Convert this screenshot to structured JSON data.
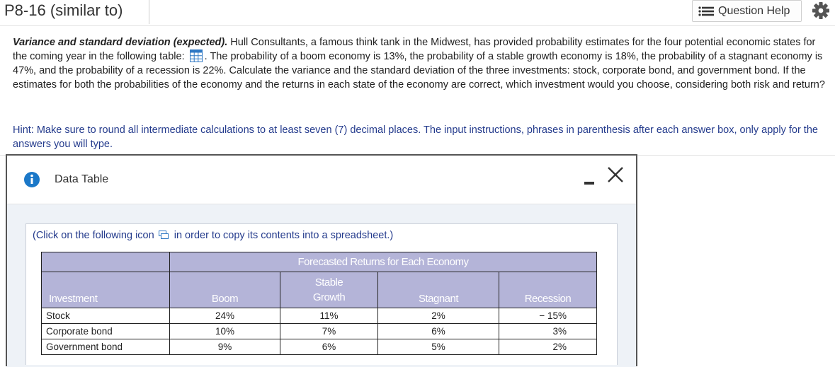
{
  "header": {
    "title": "P8-16 (similar to)",
    "question_help_label": "Question Help"
  },
  "question": {
    "lead": "Variance and standard deviation (expected).",
    "part1": " Hull Consultants, a famous think tank in the Midwest, has provided probability estimates for the four potential economic states for the coming year in the following table: ",
    "part2": ". The probability of a boom economy is 13%, the probability of a stable growth economy is 18%, the probability of a stagnant economy is 47%, and the probability of a recession is 22%. Calculate the variance and the standard deviation of the three investments: stock, corporate bond, and government bond. If the estimates for both the probabilities of the economy and the returns in each state of the economy are correct, which investment would you choose, considering both risk and return?"
  },
  "hint": "Hint: Make sure to round all intermediate calculations to at least seven (7) decimal places. The input instructions, phrases in parenthesis after each answer box, only apply for the answers you will type.",
  "dialog": {
    "title": "Data Table",
    "copy_note_before": "(Click on the following icon",
    "copy_note_after": "in order to copy its contents into a spreadsheet.)",
    "table": {
      "group_header": "Forecasted Returns for Each Economy",
      "columns": [
        "Investment",
        "Boom",
        "Stable Growth",
        "Stagnant",
        "Recession"
      ],
      "rows": [
        [
          "Stock",
          "24%",
          "11%",
          "2%",
          "− 15%"
        ],
        [
          "Corporate bond",
          "10%",
          "7%",
          "6%",
          "3%"
        ],
        [
          "Government bond",
          "9%",
          "6%",
          "5%",
          "2%"
        ]
      ]
    }
  },
  "colors": {
    "accent": "#233a8c",
    "table_header": "#b4b4d8",
    "info_icon": "#1b78c8",
    "grid_icon": "#2f78c4"
  }
}
